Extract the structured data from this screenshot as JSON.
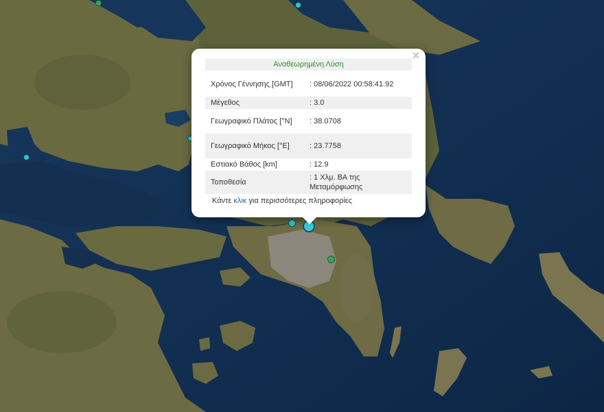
{
  "map": {
    "colors": {
      "sea_deep": "#0f2a4a",
      "sea": "#1a3d63",
      "land": "#6b6a42",
      "land_dark": "#4f5632",
      "land_urban": "#8d8a80",
      "marker_selected": "#3ec8d8",
      "marker_cyan": "#2fc4d4",
      "marker_green": "#3aa15a"
    },
    "markers": [
      {
        "name": "marker-selected",
        "color": "marker_selected",
        "selected": true
      },
      {
        "name": "marker-cyan",
        "color": "marker_cyan"
      },
      {
        "name": "marker-green",
        "color": "marker_green"
      }
    ]
  },
  "popup": {
    "title": "Αναθεωρημένη Λύση",
    "close_label": "×",
    "rows": [
      {
        "label": "Χρόνος Γέννησης [GMT]",
        "value": ": 08/06/2022 00:58:41.92"
      },
      {
        "label": "Μέγεθος",
        "value": ": 3.0"
      },
      {
        "label": "Γεωγραφικό Πλάτος [°N]",
        "value": ": 38.0708"
      },
      {
        "label": "Γεωγραφικό Μήκος [°E]",
        "value": ": 23.7758"
      },
      {
        "label": "Εστιακό Βάθος [km]",
        "value": ": 12.9"
      },
      {
        "label": "Τοποθεσία",
        "value": ": 1 Χλμ. ΒΑ της Μεταμόρφωσης"
      }
    ],
    "more_prefix": "Κάντε",
    "more_link": "κλικ",
    "more_suffix": "για περισσότερες πληροφορίες"
  }
}
